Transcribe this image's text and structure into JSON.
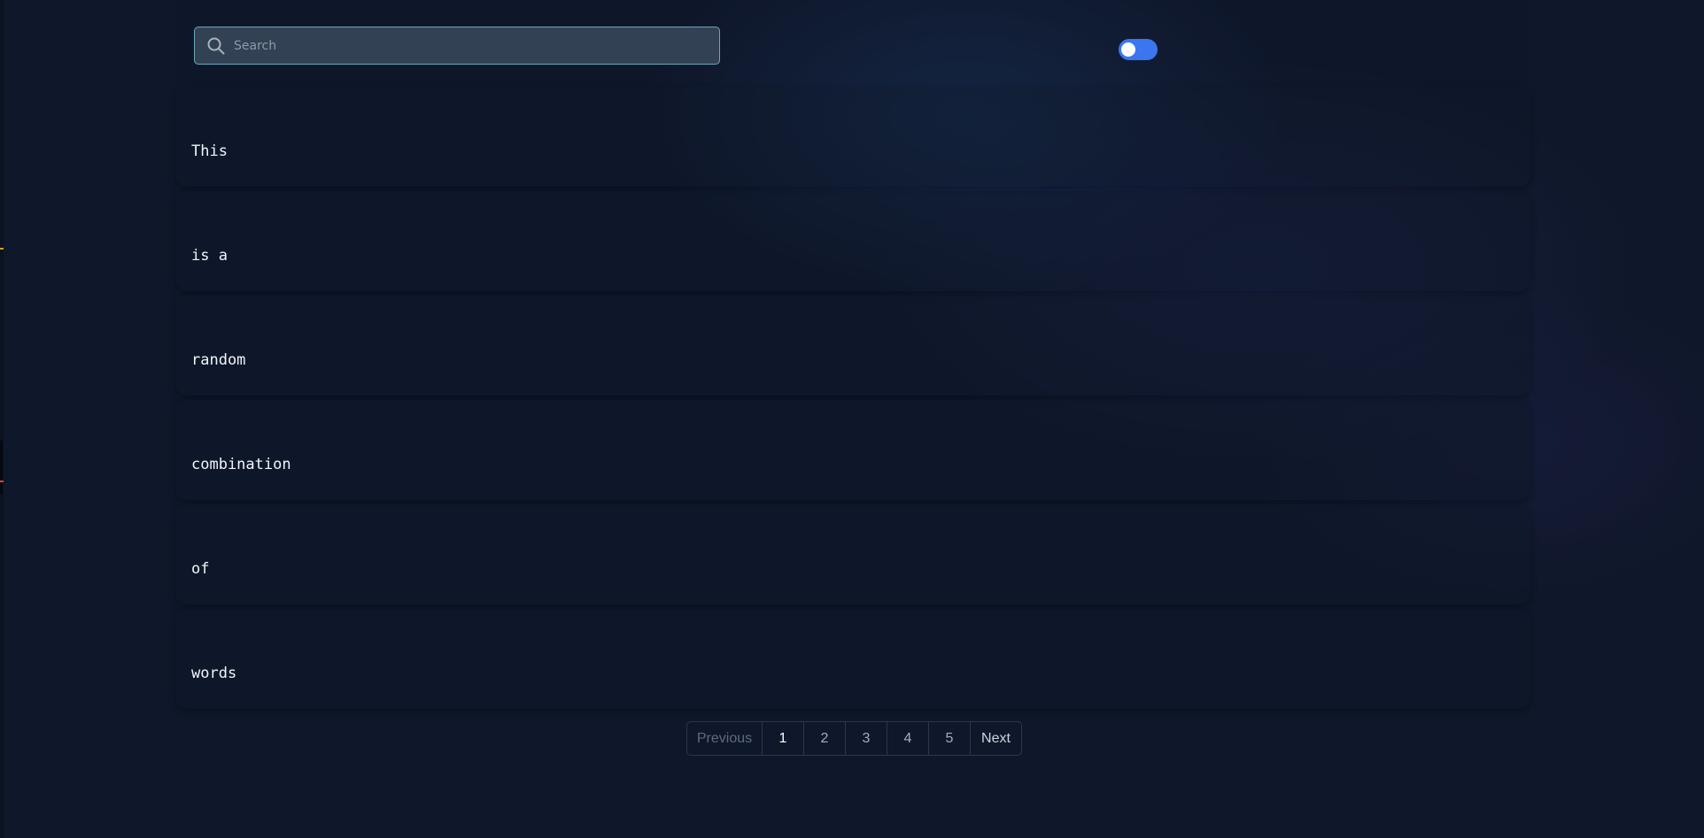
{
  "search": {
    "placeholder": "Search",
    "value": ""
  },
  "theme_toggle": {
    "state": "on",
    "accent_color": "#3b76f0"
  },
  "words": [
    "This",
    "is a",
    "random",
    "combination",
    "of",
    "words"
  ],
  "pagination": {
    "previous_label": "Previous",
    "next_label": "Next",
    "pages": [
      "1",
      "2",
      "3",
      "4",
      "5"
    ],
    "current_page": "1"
  },
  "colors": {
    "background": "#0f172a",
    "search_border": "#6aa8b7",
    "search_fill": "#334155"
  }
}
